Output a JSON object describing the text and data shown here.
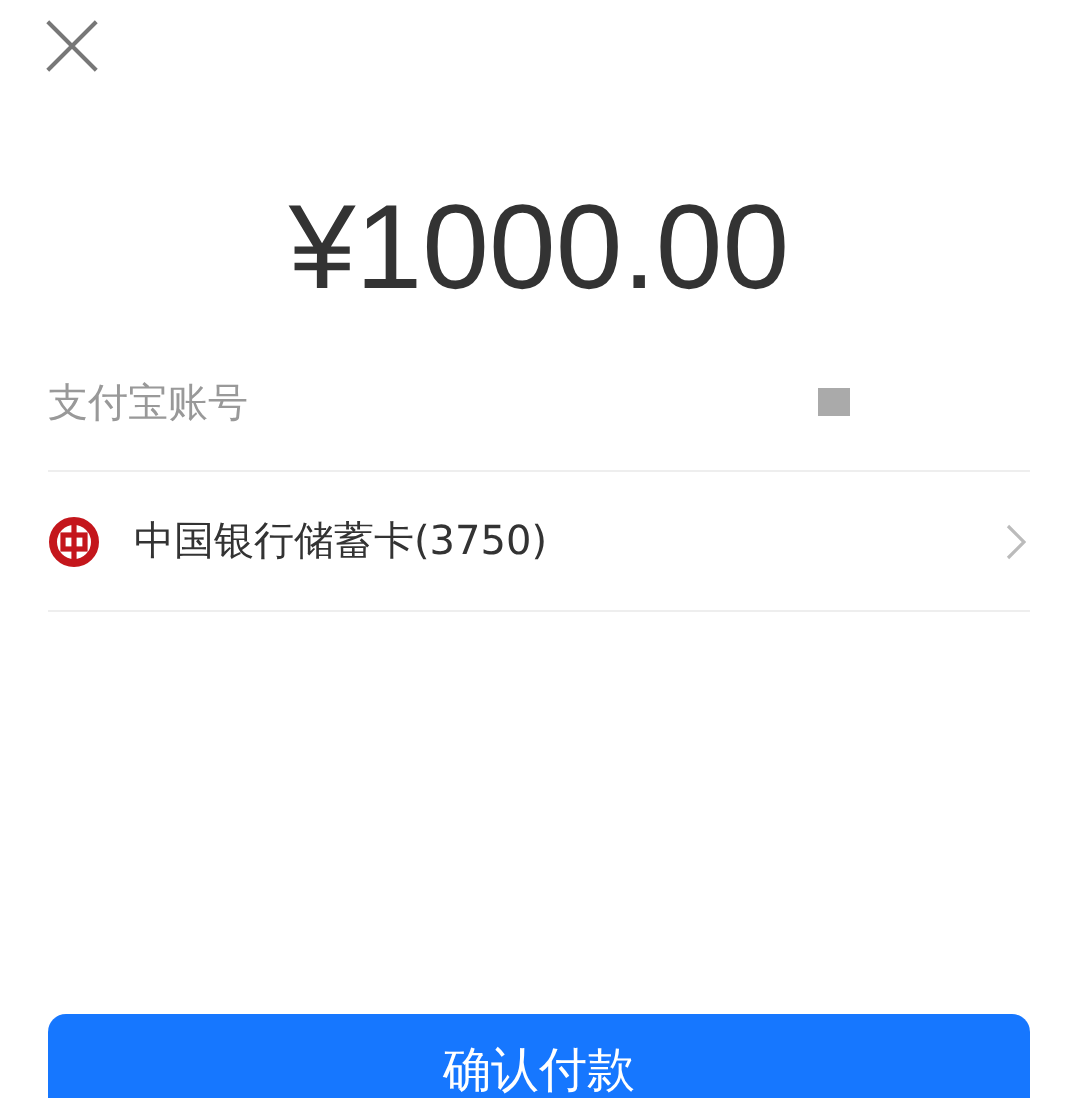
{
  "amount": "¥1000.00",
  "account_label": "支付宝账号",
  "payment_method": {
    "name": "中国银行储蓄卡(3750)"
  },
  "confirm_button": "确认付款"
}
